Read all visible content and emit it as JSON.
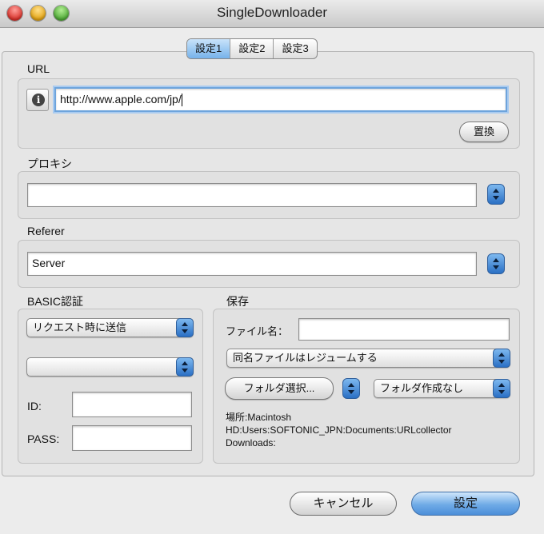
{
  "window": {
    "title": "SingleDownloader"
  },
  "tabs": [
    {
      "label": "設定1",
      "active": true
    },
    {
      "label": "設定2",
      "active": false
    },
    {
      "label": "設定3",
      "active": false
    }
  ],
  "url": {
    "label": "URL",
    "value": "http://www.apple.com/jp/",
    "replace_button": "置換",
    "info_icon": "info-icon"
  },
  "proxy": {
    "label": "プロキシ",
    "value": ""
  },
  "referer": {
    "label": "Referer",
    "value": "Server"
  },
  "basic_auth": {
    "label": "BASIC認証",
    "mode": "リクエスト時に送信",
    "second_select": "",
    "id_label": "ID:",
    "id_value": "",
    "pass_label": "PASS:",
    "pass_value": ""
  },
  "save": {
    "label": "保存",
    "filename_label": "ファイル名：",
    "filename_value": "",
    "same_name_option": "同名ファイルはレジュームする",
    "folder_select_button": "フォルダ選択...",
    "folder_create_option": "フォルダ作成なし",
    "path_lines": [
      "場所:Macintosh",
      "HD:Users:SOFTONIC_JPN:Documents:URLcollector",
      "Downloads:"
    ]
  },
  "buttons": {
    "cancel": "キャンセル",
    "ok": "設定"
  },
  "colors": {
    "accent": "#6faae6",
    "focus": "#6ea4dc"
  }
}
